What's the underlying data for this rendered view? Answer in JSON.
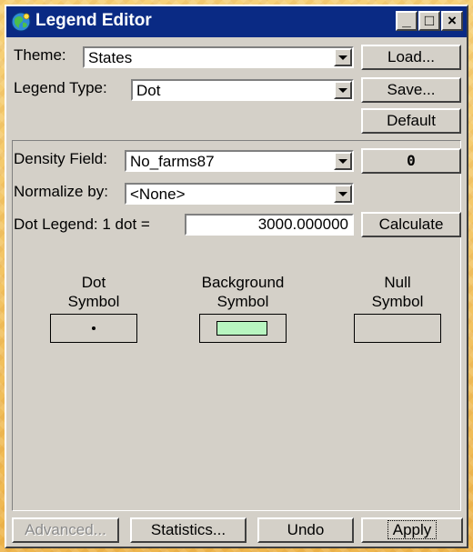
{
  "window": {
    "title": "Legend Editor",
    "title_bar_color": "#0a2a84",
    "controls": {
      "minimize": "_",
      "maximize": "□",
      "close": "×"
    }
  },
  "theme": {
    "label": "Theme:",
    "value": "States"
  },
  "legend_type": {
    "label": "Legend Type:",
    "value": "Dot"
  },
  "buttons": {
    "load": "Load...",
    "save": "Save...",
    "default": "Default"
  },
  "density_field": {
    "label": "Density Field:",
    "value": "No_farms87",
    "button": "0"
  },
  "normalize": {
    "label": "Normalize by:",
    "value": "<None>"
  },
  "dot_legend": {
    "label": "Dot Legend: 1 dot =",
    "value": "3000.000000",
    "calculate": "Calculate"
  },
  "symbols": {
    "dot": {
      "line1": "Dot",
      "line2": "Symbol"
    },
    "background": {
      "line1": "Background",
      "line2": "Symbol",
      "color": "#b8f5c0"
    },
    "null": {
      "line1": "Null",
      "line2": "Symbol"
    }
  },
  "footer": {
    "advanced": "Advanced...",
    "statistics": "Statistics...",
    "undo": "Undo",
    "apply": "Apply"
  }
}
